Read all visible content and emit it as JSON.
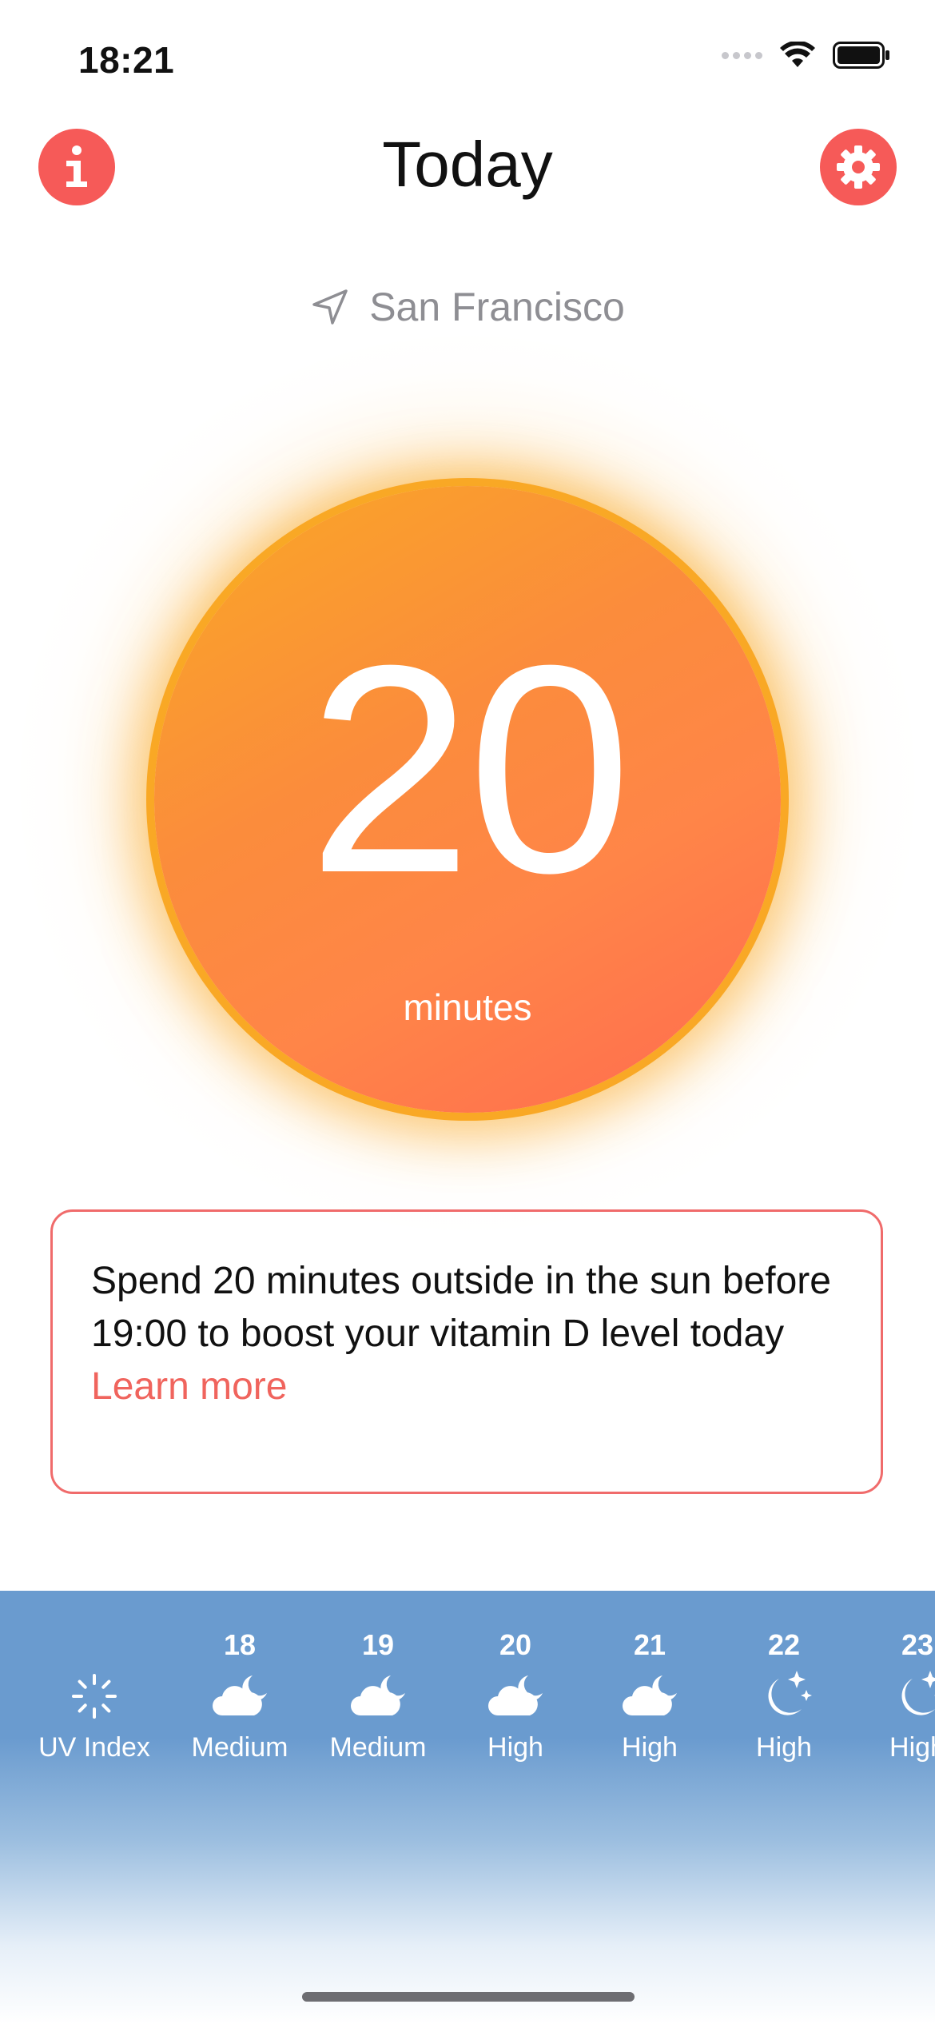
{
  "status_bar": {
    "time": "18:21"
  },
  "header": {
    "title": "Today"
  },
  "location": {
    "name": "San Francisco"
  },
  "sun": {
    "value": "20",
    "unit": "minutes"
  },
  "tip": {
    "text": "Spend 20 minutes outside in the sun before 19:00 to boost your vitamin D level today",
    "link": "Learn more"
  },
  "forecast": {
    "columns": [
      {
        "hour": "",
        "icon": "sun-outline-icon",
        "level": "UV Index"
      },
      {
        "hour": "18",
        "icon": "cloud-moon-icon",
        "level": "Medium"
      },
      {
        "hour": "19",
        "icon": "cloud-moon-icon",
        "level": "Medium"
      },
      {
        "hour": "20",
        "icon": "cloud-moon-icon",
        "level": "High"
      },
      {
        "hour": "21",
        "icon": "cloud-moon-icon",
        "level": "High"
      },
      {
        "hour": "22",
        "icon": "moon-stars-icon",
        "level": "High"
      },
      {
        "hour": "23",
        "icon": "moon-stars-icon",
        "level": "High"
      }
    ]
  },
  "colors": {
    "accent": "#f65a58",
    "sun_top": "#f9a825",
    "sun_bottom": "#ff6a50",
    "forecast_bg": "#6a9bcf",
    "link": "#f0645d"
  }
}
